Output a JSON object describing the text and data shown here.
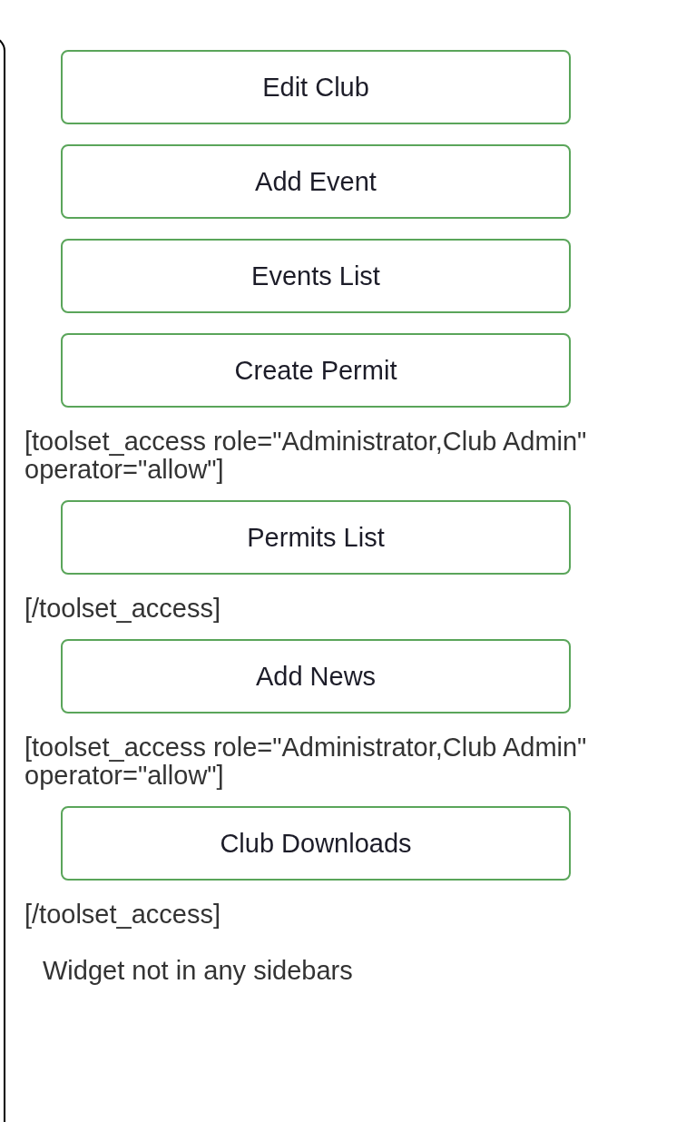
{
  "items": [
    {
      "kind": "button",
      "label": "Edit Club"
    },
    {
      "kind": "button",
      "label": "Add Event"
    },
    {
      "kind": "button",
      "label": "Events List"
    },
    {
      "kind": "button",
      "label": "Create Permit"
    },
    {
      "kind": "text",
      "text": "[toolset_access role=\"Administrator,Club Admin\" operator=\"allow\"]"
    },
    {
      "kind": "button",
      "label": "Permits List"
    },
    {
      "kind": "text",
      "text": "[/toolset_access]"
    },
    {
      "kind": "button",
      "label": "Add News"
    },
    {
      "kind": "text",
      "text": "[toolset_access role=\"Administrator,Club Admin\" operator=\"allow\"]"
    },
    {
      "kind": "button",
      "label": "Club Downloads"
    },
    {
      "kind": "text",
      "text": "[/toolset_access]"
    }
  ],
  "notice": "Widget not in any sidebars"
}
